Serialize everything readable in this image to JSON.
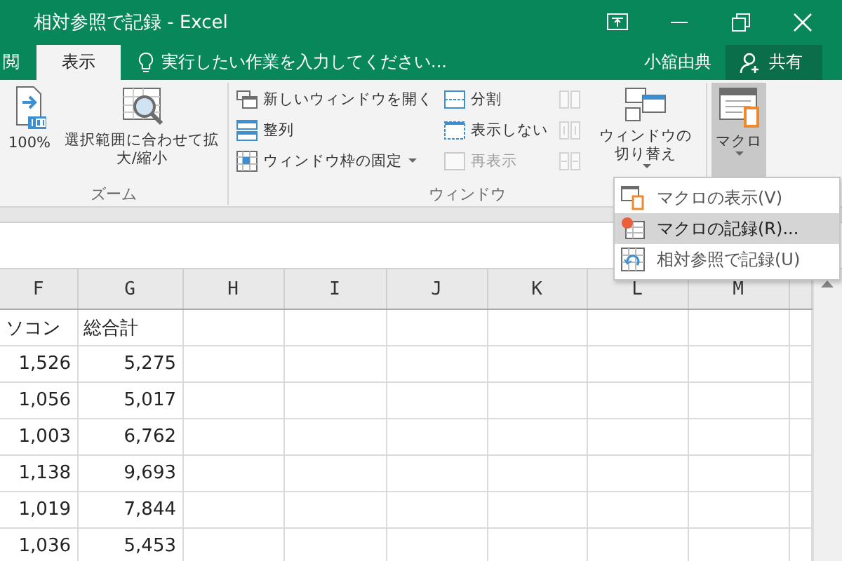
{
  "window": {
    "title": "相対参照で記録 - Excel"
  },
  "ribbon_tabs": [
    {
      "label": "閲",
      "selected": false
    },
    {
      "label": "表示",
      "selected": true
    }
  ],
  "tell_me": {
    "placeholder": "実行したい作業を入力してください..."
  },
  "user": "小舘由典",
  "share_button": "共有",
  "ribbon_groups": [
    {
      "label": "ズーム",
      "columns": [
        {
          "kind": "large",
          "items": [
            {
              "label": "100%",
              "has_menu": false,
              "disabled": false,
              "pressed": false
            }
          ]
        },
        {
          "kind": "large",
          "items": [
            {
              "label": "選択範囲に合わせて拡大/縮小",
              "has_menu": false,
              "disabled": false,
              "pressed": false
            }
          ]
        }
      ]
    },
    {
      "label": "ウィンドウ",
      "columns": [
        {
          "kind": "small",
          "items": [
            {
              "label": "新しいウィンドウを開く",
              "has_menu": false,
              "disabled": false
            },
            {
              "label": "整列",
              "has_menu": false,
              "disabled": false
            },
            {
              "label": "ウィンドウ枠の固定",
              "has_menu": true,
              "disabled": false
            }
          ]
        },
        {
          "kind": "small",
          "items": [
            {
              "label": "分割",
              "has_menu": false,
              "disabled": false
            },
            {
              "label": "表示しない",
              "has_menu": false,
              "disabled": false
            },
            {
              "label": "再表示",
              "has_menu": false,
              "disabled": true
            }
          ]
        },
        {
          "kind": "small",
          "items": [
            {
              "has_menu": false,
              "disabled": true
            },
            {
              "has_menu": false,
              "disabled": true
            },
            {
              "has_menu": false,
              "disabled": true
            }
          ]
        },
        {
          "kind": "large",
          "items": [
            {
              "label": "ウィンドウの切り替え",
              "has_menu": true,
              "disabled": false,
              "pressed": false
            }
          ]
        }
      ]
    },
    {
      "columns": [
        {
          "kind": "large",
          "items": [
            {
              "label": "マクロ",
              "has_menu": true,
              "disabled": false,
              "pressed": true
            }
          ]
        }
      ]
    }
  ],
  "macro_menu": [
    {
      "label": "マクロの表示(V)",
      "selected": false
    },
    {
      "label": "マクロの記録(R)...",
      "selected": true
    },
    {
      "label": "相対参照で記録(U)",
      "selected": false
    }
  ],
  "sheet": {
    "columns": [
      {
        "label": "F"
      },
      {
        "label": "G"
      },
      {
        "label": "H"
      },
      {
        "label": "I"
      },
      {
        "label": "J"
      },
      {
        "label": "K"
      },
      {
        "label": "L"
      },
      {
        "label": "M"
      }
    ],
    "rows": [
      {
        "kind": "text",
        "cells": [
          "ソコン",
          "総合計"
        ]
      },
      {
        "kind": "number",
        "cells": [
          "1,526",
          "5,275"
        ]
      },
      {
        "kind": "number",
        "cells": [
          "1,056",
          "5,017"
        ]
      },
      {
        "kind": "number",
        "cells": [
          "1,003",
          "6,762"
        ]
      },
      {
        "kind": "number",
        "cells": [
          "1,138",
          "9,693"
        ]
      },
      {
        "kind": "number",
        "cells": [
          "1,019",
          "7,844"
        ]
      },
      {
        "kind": "number",
        "cells": [
          "1,036",
          "5,453"
        ]
      }
    ]
  }
}
